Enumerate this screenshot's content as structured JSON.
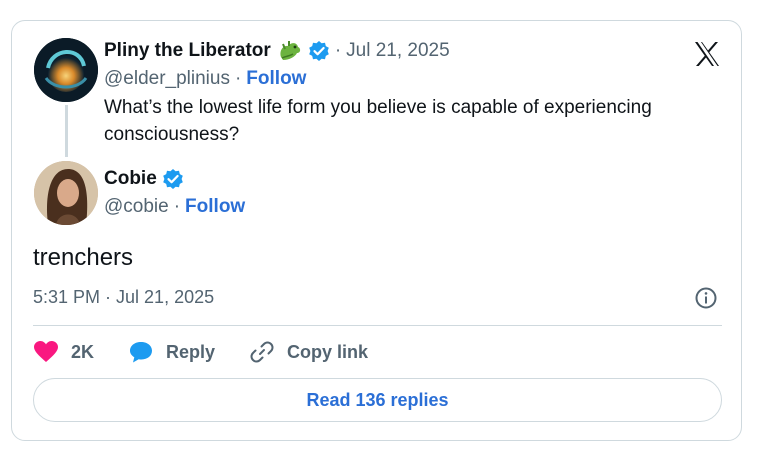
{
  "quoted_post": {
    "author_name": "Pliny the Liberator",
    "author_emoji": "dragon-emoji",
    "verified": true,
    "separator": "·",
    "date": "Jul 21, 2025",
    "handle": "@elder_plinius",
    "follow_label": "Follow",
    "text": "What’s the lowest life form you believe is capable of experiencing consciousness?"
  },
  "reply_post": {
    "author_name": "Cobie",
    "verified": true,
    "separator": "·",
    "handle": "@cobie",
    "follow_label": "Follow",
    "text": "trenchers",
    "timestamp": "5:31 PM · Jul 21, 2025"
  },
  "actions": {
    "likes_count": "2K",
    "reply_label": "Reply",
    "copy_link_label": "Copy link"
  },
  "read_replies_label": "Read 136 replies",
  "colors": {
    "accent": "#2b6fd6",
    "verified": "#1d9bf0",
    "like": "#f91880",
    "muted": "#536471",
    "border": "#cfd9de"
  },
  "icons": [
    "x-logo-icon",
    "verified-icon",
    "dragon-icon",
    "info-icon",
    "heart-icon",
    "reply-bubble-icon",
    "link-icon"
  ]
}
